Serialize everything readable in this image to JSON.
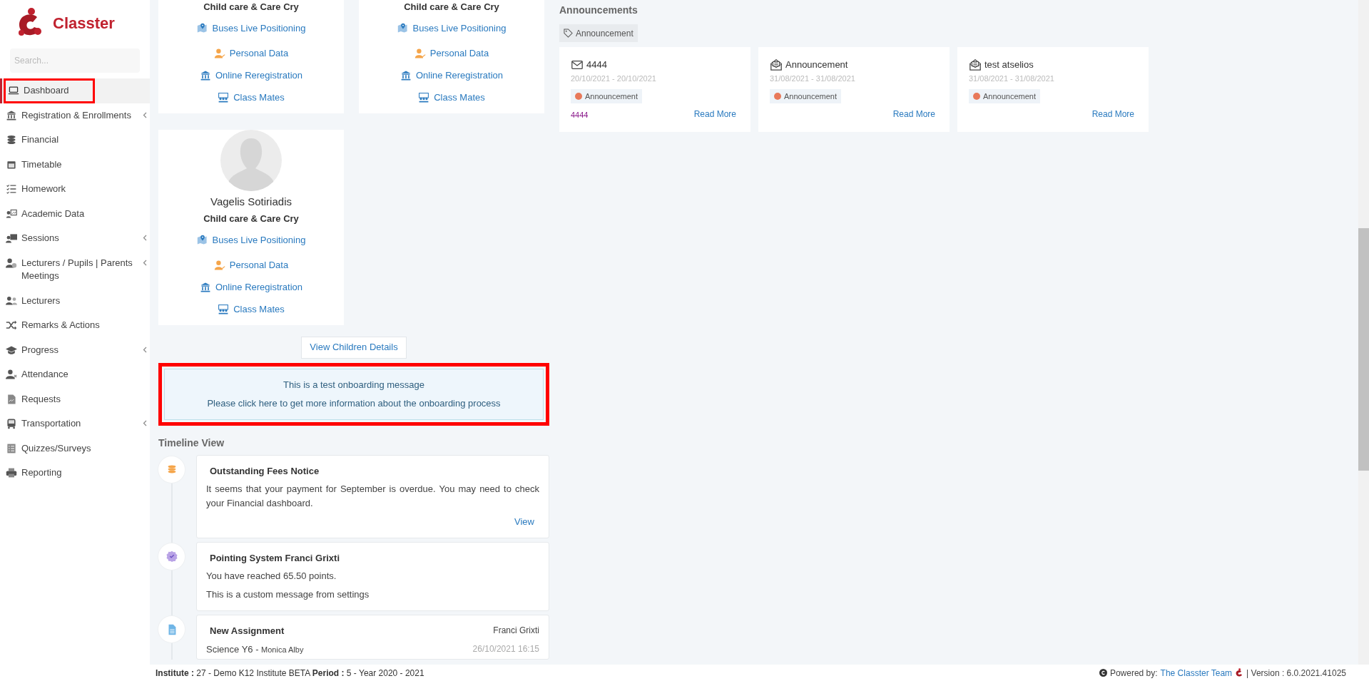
{
  "sidebar": {
    "logo_text": "Classter",
    "search": {
      "placeholder": "Search..."
    },
    "items": [
      {
        "kind": "laptop",
        "label": "Dashboard",
        "selected": true,
        "highlighted": true,
        "expandable": false
      },
      {
        "kind": "bank",
        "label": "Registration & Enrollments",
        "selected": false,
        "highlighted": false,
        "expandable": true
      },
      {
        "kind": "coins",
        "label": "Financial",
        "selected": false,
        "highlighted": false,
        "expandable": false
      },
      {
        "kind": "calendar",
        "label": "Timetable",
        "selected": false,
        "highlighted": false,
        "expandable": false
      },
      {
        "kind": "checklist",
        "label": "Homework",
        "selected": false,
        "highlighted": false,
        "expandable": false
      },
      {
        "kind": "chart",
        "label": "Academic Data",
        "selected": false,
        "highlighted": false,
        "expandable": false
      },
      {
        "kind": "presentation",
        "label": "Sessions",
        "selected": false,
        "highlighted": false,
        "expandable": true
      },
      {
        "kind": "person_clock",
        "label": "Lecturers / Pupils | Parents Meetings",
        "selected": false,
        "highlighted": false,
        "expandable": true
      },
      {
        "kind": "people",
        "label": "Lecturers",
        "selected": false,
        "highlighted": false,
        "expandable": false
      },
      {
        "kind": "shuffle",
        "label": "Remarks & Actions",
        "selected": false,
        "highlighted": false,
        "expandable": false
      },
      {
        "kind": "cap",
        "label": "Progress",
        "selected": false,
        "highlighted": false,
        "expandable": true
      },
      {
        "kind": "person_x",
        "label": "Attendance",
        "selected": false,
        "highlighted": false,
        "expandable": false
      },
      {
        "kind": "document",
        "label": "Requests",
        "selected": false,
        "highlighted": false,
        "expandable": false
      },
      {
        "kind": "bus",
        "label": "Transportation",
        "selected": false,
        "highlighted": false,
        "expandable": true
      },
      {
        "kind": "list",
        "label": "Quizzes/Surveys",
        "selected": false,
        "highlighted": false,
        "expandable": false
      },
      {
        "kind": "printer",
        "label": "Reporting",
        "selected": false,
        "highlighted": false,
        "expandable": false
      }
    ]
  },
  "children": [
    {
      "school": "Child care & Care Cry",
      "links": [
        {
          "kind": "map",
          "label": "Buses Live Positioning"
        },
        {
          "kind": "person",
          "label": "Personal Data"
        },
        {
          "kind": "bank",
          "label": "Online Reregistration"
        },
        {
          "kind": "group",
          "label": "Class Mates"
        }
      ]
    },
    {
      "school": "Child care & Care Cry",
      "links": [
        {
          "kind": "map",
          "label": "Buses Live Positioning"
        },
        {
          "kind": "person",
          "label": "Personal Data"
        },
        {
          "kind": "bank",
          "label": "Online Reregistration"
        },
        {
          "kind": "group",
          "label": "Class Mates"
        }
      ]
    },
    {
      "name": "Vagelis Sotiriadis",
      "school": "Child care & Care Cry",
      "links": [
        {
          "kind": "map",
          "label": "Buses Live Positioning"
        },
        {
          "kind": "person",
          "label": "Personal Data"
        },
        {
          "kind": "bank",
          "label": "Online Reregistration"
        },
        {
          "kind": "group",
          "label": "Class Mates"
        }
      ]
    }
  ],
  "view_children_button": "View Children Details",
  "onboarding": {
    "highlighted": true,
    "lines": [
      "This is a test onboarding message",
      "Please click here to get more information about the onboarding process"
    ]
  },
  "timeline": {
    "heading": "Timeline View",
    "items": [
      {
        "kind": "fees",
        "title": "Outstanding Fees Notice",
        "lines": [
          "It seems that your payment for September is overdue. You may need to check your Financial dashboard."
        ],
        "link": "View"
      },
      {
        "kind": "points",
        "title": "Pointing System Franci Grixti",
        "lines": [
          "You have reached 65.50 points.",
          "This is a custom message from settings"
        ]
      },
      {
        "kind": "assignment",
        "title": "New Assignment",
        "author": "Franci Grixti",
        "subject": "Science Y6 -",
        "teacher": "Monica Alby",
        "date": "26/10/2021 16:15"
      }
    ]
  },
  "announcements": {
    "heading": "Announcements",
    "filter": "Announcement",
    "cards": [
      {
        "kind": "mail",
        "title": "4444",
        "dates": "20/10/2021 - 20/10/2021",
        "tag": "Announcement",
        "color": "#e8795a",
        "body": "4444",
        "link": "Read More"
      },
      {
        "kind": "open_mail",
        "title": "Announcement",
        "dates": "31/08/2021 - 31/08/2021",
        "tag": "Announcement",
        "color": "#e8795a",
        "link": "Read More"
      },
      {
        "kind": "open_mail",
        "title": "test atselios",
        "dates": "31/08/2021 - 31/08/2021",
        "tag": "Announcement",
        "color": "#e8795a",
        "link": "Read More"
      }
    ]
  },
  "footer": {
    "info": "**Institute :** 27 - Demo K12 Institute BETA **Period :** 5 - Year 2020 - 2021",
    "powered_by": "Powered by:",
    "team_link": "The Classter Team",
    "version": "| Version : 6.0.2021.41025"
  }
}
